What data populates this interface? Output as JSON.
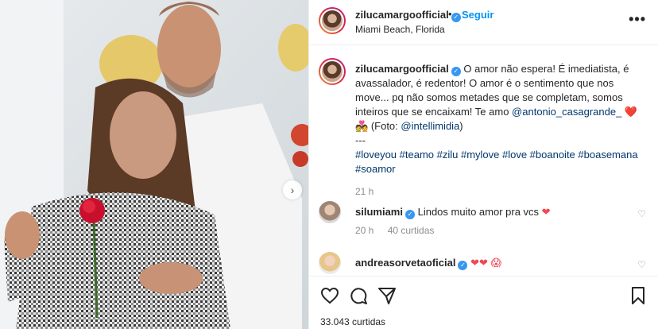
{
  "header": {
    "username": "zilucamargoofficial",
    "dot": "•",
    "follow_label": "Seguir",
    "location": "Miami Beach, Florida",
    "more_label": "•••"
  },
  "photo": {
    "next_label": "›"
  },
  "caption": {
    "username": "zilucamargoofficial",
    "text": "O amor não espera! É imediatista, é avassalador, é redentor! O amor é o sentimento que nos move... pq não somos metades que se completam, somos inteiros que se encaixam! Te amo",
    "mention1": "@antonio_casagrande_",
    "emoji": "❤️ 💑",
    "photo_credit_prefix": "(Foto:",
    "mention2": "@intellimidia",
    "photo_credit_suffix": ")",
    "separator": "---",
    "hashtags": "#loveyou #teamo #zilu #mylove #love #boanoite #boasemana #soamor",
    "time": "21 h"
  },
  "comments": [
    {
      "username": "silumiami",
      "text": "Lindos muito amor pra vcs",
      "emoji": "❤",
      "time": "20 h",
      "likes": "40 curtidas"
    },
    {
      "username": "andreasorvetaoficial",
      "text": "",
      "emoji": "❤❤ 😱"
    }
  ],
  "footer": {
    "likes": "33.043 curtidas"
  },
  "colors": {
    "accent": "#0095f6",
    "heart": "#ed4956",
    "verified": "#3897f0"
  }
}
